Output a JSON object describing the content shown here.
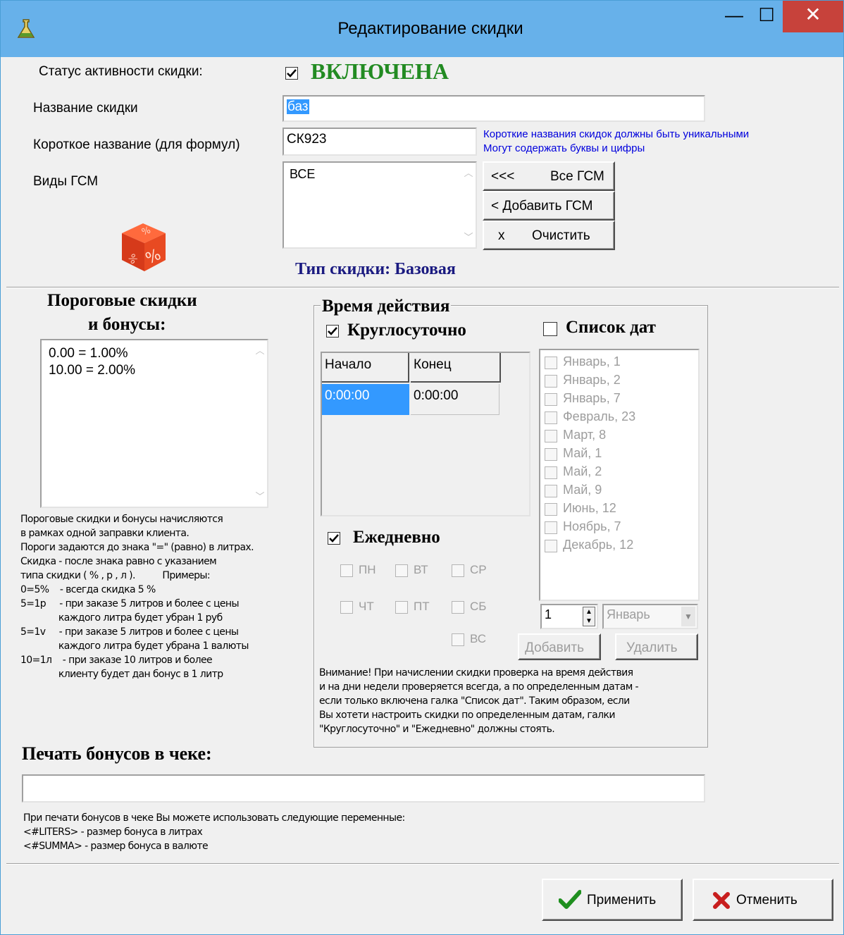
{
  "window": {
    "title": "Редактирование скидки",
    "minimize_label": "—",
    "maximize_label": "☐",
    "close_label": "✕"
  },
  "status": {
    "label": "Статус активности скидки:",
    "value": "ВКЛЮЧЕНА",
    "checked": true
  },
  "name": {
    "label": "Название скидки",
    "value": "баз"
  },
  "short_name": {
    "label": "Короткое название (для формул)",
    "value": "СК923",
    "note_line1": "Короткие названия скидок должны быть уникальными",
    "note_line2": "Могут содержать буквы и цифры"
  },
  "fuel": {
    "label": "Виды ГСМ",
    "items": [
      "ВСЕ"
    ],
    "buttons": {
      "all_arrows": "<<<",
      "all_label": "Все ГСМ",
      "add_label": "< Добавить ГСМ",
      "clear_x": "x",
      "clear_label": "Очистить"
    }
  },
  "discount_type": {
    "text": "Тип скидки: Базовая"
  },
  "thresholds": {
    "title_line1": "Пороговые скидки",
    "title_line2": "и бонусы:",
    "items": [
      "0.00 = 1.00%",
      "10.00 = 2.00%"
    ],
    "help": [
      "Пороговые скидки и бонусы начисляются",
      "в рамках одной заправки клиента.",
      "Пороги задаются до знака \"=\" (равно) в литрах.",
      "Скидка - после знака равно с указанием",
      "типа скидки ( % , р , л ).          Примеры:",
      "0=5%    - всегда скидка 5 %",
      "5=1р     - при заказе 5 литров и более с цены",
      "              каждого литра будет убран 1 руб",
      "5=1v     - при заказе 5 литров и более с цены",
      "              каждого литра будет убрана 1 валюты",
      "10=1л    - при заказе 10 литров и более",
      "              клиенту будет дан бонус в 1 литр"
    ]
  },
  "time": {
    "group_title": "Время действия",
    "around_clock": {
      "label": "Круглосуточно",
      "checked": true
    },
    "grid": {
      "headers": [
        "Начало",
        "Конец"
      ],
      "rows": [
        [
          "0:00:00",
          "0:00:00"
        ]
      ]
    },
    "daily": {
      "label": "Ежедневно",
      "checked": true
    },
    "weekdays": [
      "ПН",
      "ВТ",
      "СР",
      "ЧТ",
      "ПТ",
      "СБ",
      "ВС"
    ],
    "date_list": {
      "label": "Список дат",
      "checked": false,
      "items": [
        "Январь, 1",
        "Январь, 2",
        "Январь, 7",
        "Февраль, 23",
        "Март, 8",
        "Май, 1",
        "Май, 2",
        "Май, 9",
        "Июнь, 12",
        "Ноябрь, 7",
        "Декабрь, 12"
      ],
      "day_value": "1",
      "month_value": "Январь",
      "add_label": "Добавить",
      "remove_label": "Удалить"
    },
    "warning": [
      "Внимание! При начислении скидки проверка на время действия",
      "и на дни недели проверяется всегда, а по определенным датам -",
      "если только включена галка \"Список дат\". Таким образом, если",
      "Вы хотети настроить скидки по определенным датам, галки",
      "\"Круглосуточно\" и \"Ежедневно\" должны стоять."
    ]
  },
  "print_bonus": {
    "title": "Печать бонусов в чеке:",
    "value": "",
    "help": [
      "При печати бонусов в чеке Вы можете использовать следующие переменные:",
      "<#LITERS> - размер бонуса в литрах",
      "<#SUMMA> - размер бонуса в валюте"
    ]
  },
  "footer": {
    "apply_label": "Применить",
    "cancel_label": "Отменить"
  },
  "colors": {
    "status_green": "#228b22",
    "dark_blue": "#1a1a80",
    "note_blue": "#0000dd",
    "selection": "#3399ff",
    "titlebar": "#67b1ea",
    "close_red": "#c7423b"
  },
  "icons": {
    "app": "flask-icon",
    "discount": "percent-cube-icon",
    "apply": "checkmark-icon",
    "cancel": "red-x-icon"
  }
}
